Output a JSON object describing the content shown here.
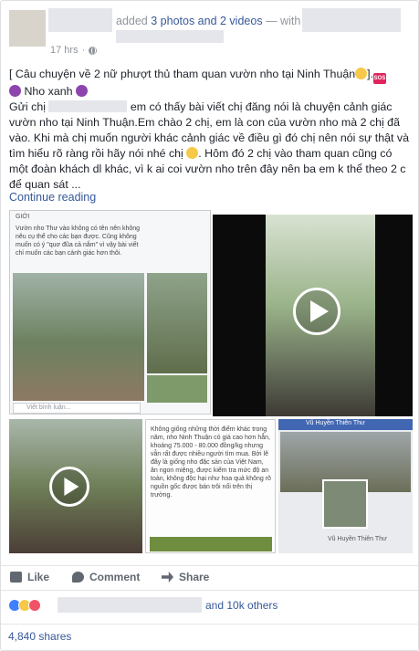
{
  "header": {
    "action_prefix": "added",
    "photos_videos": "3 photos and 2 videos",
    "with_label": "— with",
    "time": "17 hrs",
    "separator": "·"
  },
  "post": {
    "line1_before": "[ Câu chuyện về 2 nữ phượt thủ tham quan vườn nho tại Ninh Thuận",
    "line1_after": "].",
    "line2": "Nho xanh",
    "greeting": "Gửi chị",
    "body1": " em có thấy bài viết chị đăng nói là chuyện cảnh giác vườn nho tại Ninh Thuận.Em chào 2 chị, em là con của vườn nho mà 2 chị đã vào. Khi mà chị muốn người khác cảnh giác về điều gì đó chị nên nói sự thật và tìm hiểu rõ ràng rồi hãy nói nhé chị",
    "body2": ". Hôm đó 2 chị vào tham quan cũng có một đoàn khách dl khác, vì k ai coi vườn nho trên đây nên ba em k thể theo 2 c để quan sát ...",
    "continue": "Continue reading"
  },
  "media": {
    "doc1_label": "GIỚI",
    "doc1_text": "Vườn nho Thư vào không có tên nên không nêu cụ thể cho các bạn được. Cũng không muốn có ý \"quơ đũa cả nắm\" vì vậy bài viết chỉ muốn các bạn cảnh giác hơn thôi.",
    "doc1_comment": "Viết bình luận...",
    "doc2_text": "Không giống những thời điểm khác trong năm, nho Ninh Thuận có giá cao hơn hẳn, khoảng 75.000 - 80.000 đồng/kg nhưng vẫn rất được nhiều người tìm mua. Bởi lẽ đây là giống nho đặc sản của Việt Nam, ăn ngon miệng, được kiểm tra mức độ an toàn, không độc hại như hoa quả không rõ nguồn gốc được bán trôi nổi trên thị trường.",
    "profile_name": "Vũ Huyền Thiên Thư",
    "profile_caption": "Vũ Huyền Thiên Thư"
  },
  "actions": {
    "like": "Like",
    "comment": "Comment",
    "share": "Share"
  },
  "reactions": {
    "others": "and 10k others",
    "shares": "4,840 shares"
  }
}
